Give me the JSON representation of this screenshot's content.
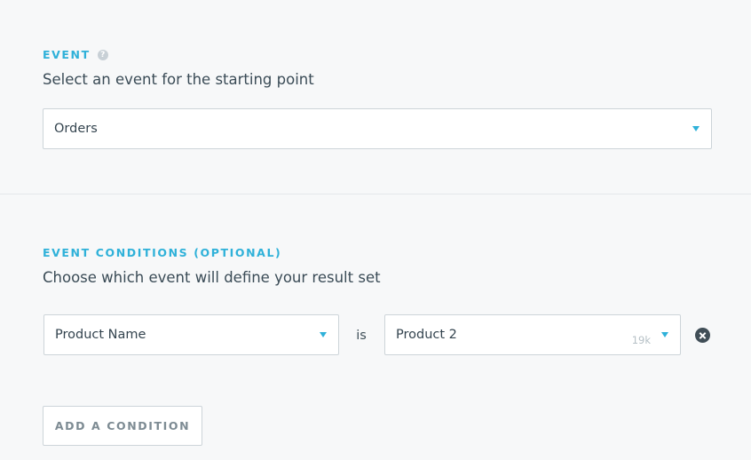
{
  "event_section": {
    "heading": "EVENT",
    "help_icon": "?",
    "subtitle": "Select an event for the starting point",
    "select": {
      "value": "Orders",
      "icon": "chevron-down-icon"
    }
  },
  "conditions_section": {
    "heading": "EVENT CONDITIONS (OPTIONAL)",
    "subtitle": "Choose which event will define your result set",
    "conditions": [
      {
        "property": {
          "value": "Product Name",
          "icon": "chevron-down-icon"
        },
        "operator": "is",
        "value": {
          "value": "Product 2",
          "count": "19k",
          "icon": "chevron-down-icon"
        },
        "remove_icon": "close-circle-icon"
      }
    ],
    "add_button_label": "ADD A CONDITION"
  },
  "colors": {
    "accent": "#2fb1d9",
    "text": "#3e4e58",
    "background": "#f7f8f9",
    "border": "#cdd4d9",
    "muted": "#7d8b93"
  }
}
